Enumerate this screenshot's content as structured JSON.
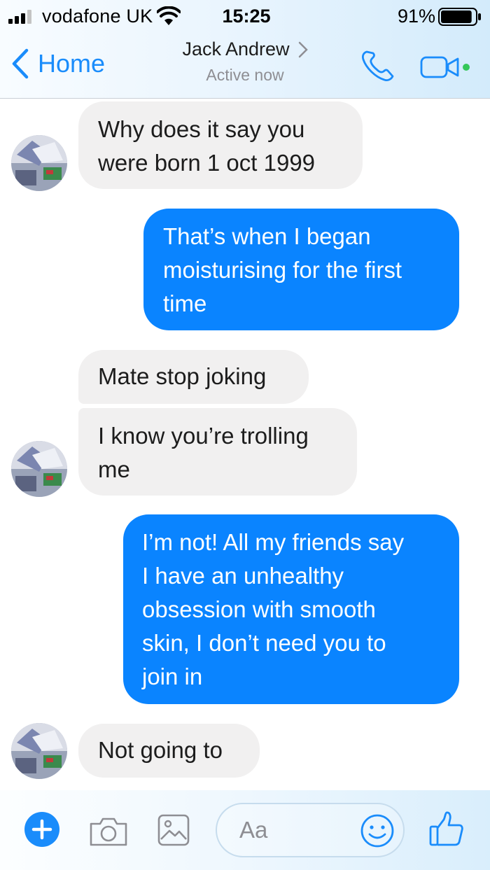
{
  "status_bar": {
    "carrier": "vodafone UK",
    "time": "15:25",
    "battery_percent": "91%",
    "battery_level": 0.91
  },
  "header": {
    "back_label": "Home",
    "contact_name": "Jack Andrew",
    "active_status": "Active now",
    "accent_color": "#1a8cfb",
    "online_color": "#34c759"
  },
  "messages": [
    {
      "direction": "incoming",
      "text_lines": [
        "Why does it say you",
        "were born 1 oct 1999"
      ]
    },
    {
      "direction": "outgoing",
      "text_lines": [
        "That’s when I began",
        "moisturising for the first",
        "time"
      ]
    },
    {
      "direction": "incoming",
      "text_lines": [
        "Mate stop joking"
      ]
    },
    {
      "direction": "incoming",
      "text_lines": [
        "I know you’re trolling",
        "me"
      ]
    },
    {
      "direction": "outgoing",
      "text_lines": [
        "I’m not! All my friends say",
        "I have an unhealthy",
        "obsession with smooth",
        "skin, I don’t need you to",
        "join in"
      ]
    },
    {
      "direction": "incoming",
      "text_lines": [
        "Not going to"
      ]
    }
  ],
  "composer": {
    "placeholder": "Aa",
    "icons": [
      "plus-icon",
      "camera-icon",
      "gallery-icon",
      "emoji-icon",
      "thumbs-up-icon"
    ]
  },
  "colors": {
    "outgoing_bubble": "#0a84ff",
    "incoming_bubble": "#f1f0f0"
  }
}
